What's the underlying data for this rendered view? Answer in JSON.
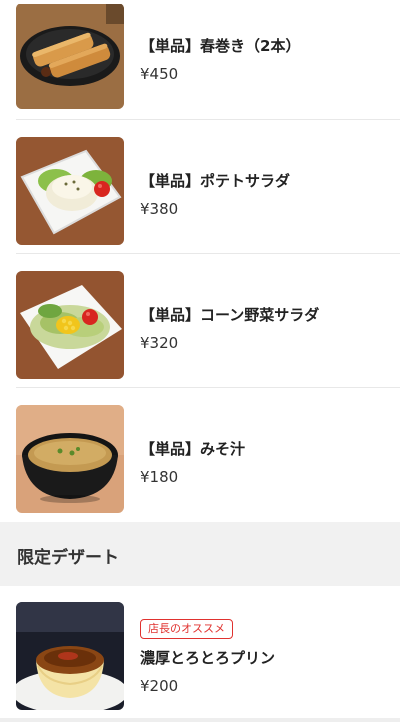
{
  "items": [
    {
      "name": "【単品】春巻き（2本）",
      "price": "¥450",
      "image_icon": "spring-rolls-photo"
    },
    {
      "name": "【単品】ポテトサラダ",
      "price": "¥380",
      "image_icon": "potato-salad-photo"
    },
    {
      "name": "【単品】コーン野菜サラダ",
      "price": "¥320",
      "image_icon": "corn-salad-photo"
    },
    {
      "name": "【単品】みそ汁",
      "price": "¥180",
      "image_icon": "miso-soup-photo"
    }
  ],
  "dessert_section": {
    "title": "限定デザート",
    "items": [
      {
        "badge": "店長のオススメ",
        "name": "濃厚とろとろプリン",
        "price": "¥200",
        "image_icon": "pudding-photo"
      }
    ]
  },
  "colors": {
    "badge": "#e0322f",
    "section_bg": "#f1f1f1",
    "divider": "#e8e8e8"
  }
}
